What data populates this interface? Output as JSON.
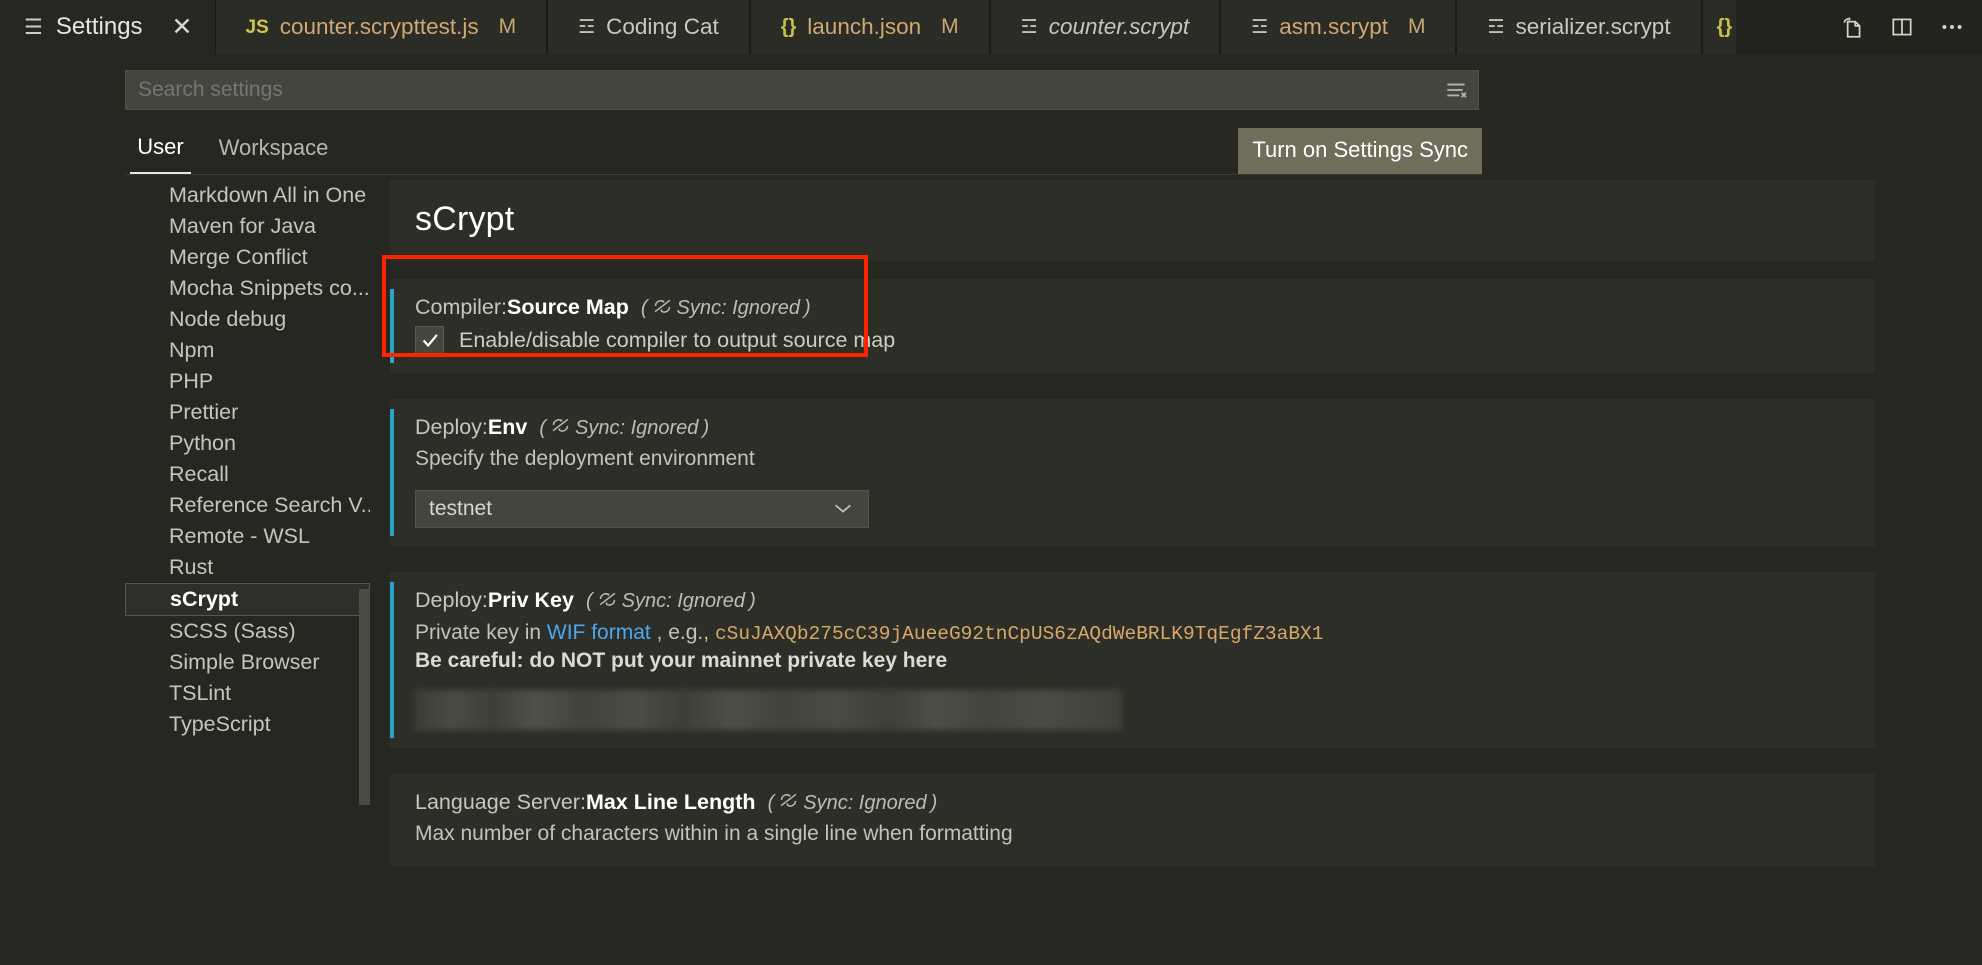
{
  "window": {
    "settings_tab_label": "Settings",
    "settings_tab_icon": "settings-lines-icon",
    "close_icon": "close-icon"
  },
  "tabs": [
    {
      "name": "counter.scrypttest.js",
      "icon": "js-file-icon",
      "icon_text": "JS",
      "badge": "M",
      "italic": false
    },
    {
      "name": "Coding Cat",
      "icon": "text-file-icon",
      "icon_text": "☲",
      "badge": "",
      "italic": false
    },
    {
      "name": "launch.json",
      "icon": "json-file-icon",
      "icon_text": "{}",
      "badge": "M",
      "italic": false
    },
    {
      "name": "counter.scrypt",
      "icon": "text-file-icon",
      "icon_text": "☲",
      "badge": "",
      "italic": true
    },
    {
      "name": "asm.scrypt",
      "icon": "text-file-icon",
      "icon_text": "☲",
      "badge": "M",
      "italic": false
    },
    {
      "name": "serializer.scrypt",
      "icon": "text-file-icon",
      "icon_text": "☲",
      "badge": "",
      "italic": false
    }
  ],
  "tab_overflow": {
    "icon_text": "{}",
    "icon": "json-file-icon"
  },
  "editor_actions": [
    {
      "name": "open-changes-icon",
      "title": "Open Changes"
    },
    {
      "name": "split-editor-icon",
      "title": "Split Editor"
    },
    {
      "name": "more-actions-icon",
      "title": "More Actions"
    }
  ],
  "search": {
    "placeholder": "Search settings",
    "value": "",
    "clear_filter_icon": "clear-filter-icon"
  },
  "scope_tabs": {
    "user": "User",
    "workspace": "Workspace",
    "active": "User"
  },
  "settings_sync_button": "Turn on Settings Sync",
  "sidebar": {
    "items": [
      {
        "label": "Markdown All in One",
        "selected": false
      },
      {
        "label": "Maven for Java",
        "selected": false
      },
      {
        "label": "Merge Conflict",
        "selected": false
      },
      {
        "label": "Mocha Snippets co...",
        "selected": false
      },
      {
        "label": "Node debug",
        "selected": false
      },
      {
        "label": "Npm",
        "selected": false
      },
      {
        "label": "PHP",
        "selected": false
      },
      {
        "label": "Prettier",
        "selected": false
      },
      {
        "label": "Python",
        "selected": false
      },
      {
        "label": "Recall",
        "selected": false
      },
      {
        "label": "Reference Search V...",
        "selected": false
      },
      {
        "label": "Remote - WSL",
        "selected": false
      },
      {
        "label": "Rust",
        "selected": false
      },
      {
        "label": "sCrypt",
        "selected": true
      },
      {
        "label": "SCSS (Sass)",
        "selected": false
      },
      {
        "label": "Simple Browser",
        "selected": false
      },
      {
        "label": "TSLint",
        "selected": false
      },
      {
        "label": "TypeScript",
        "selected": false
      }
    ]
  },
  "section": {
    "title": "sCrypt"
  },
  "sync_label": "Sync: Ignored",
  "settings": {
    "source_map": {
      "prefix": "Compiler: ",
      "name": "Source Map",
      "sync": "Sync: Ignored",
      "checkbox_label": "Enable/disable compiler to output source map",
      "checked": true,
      "highlighted": true
    },
    "deploy_env": {
      "prefix": "Deploy: ",
      "name": "Env",
      "sync": "Sync: Ignored",
      "description": "Specify the deployment environment",
      "value": "testnet",
      "chevron_icon": "chevron-down-icon"
    },
    "deploy_priv_key": {
      "prefix": "Deploy: ",
      "name": "Priv Key",
      "sync": "Sync: Ignored",
      "desc_prefix": "Private key in ",
      "link_text": "WIF format",
      "desc_mid": " , e.g., ",
      "example_key": "cSuJAXQb275cC39jAueeG92tnCpUS6zAQdWeBRLK9TqEgfZ3aBX1",
      "warning": "Be careful: do NOT put your mainnet private key here",
      "input_value": "",
      "input_obscured": true
    },
    "max_line_length": {
      "prefix": "Language Server: ",
      "name": "Max Line Length",
      "sync": "Sync: Ignored",
      "description": "Max number of characters within in a single line when formatting"
    }
  },
  "colors": {
    "background": "#262720",
    "tabbar": "#22231d",
    "row_background": "#2d2e27",
    "accent_bar": "#2aa5c7",
    "annotation": "#ff2400",
    "link": "#4ba7f0",
    "code": "#d5a96a",
    "sync_button": "#6f6e5b",
    "search_field": "#43463c"
  }
}
